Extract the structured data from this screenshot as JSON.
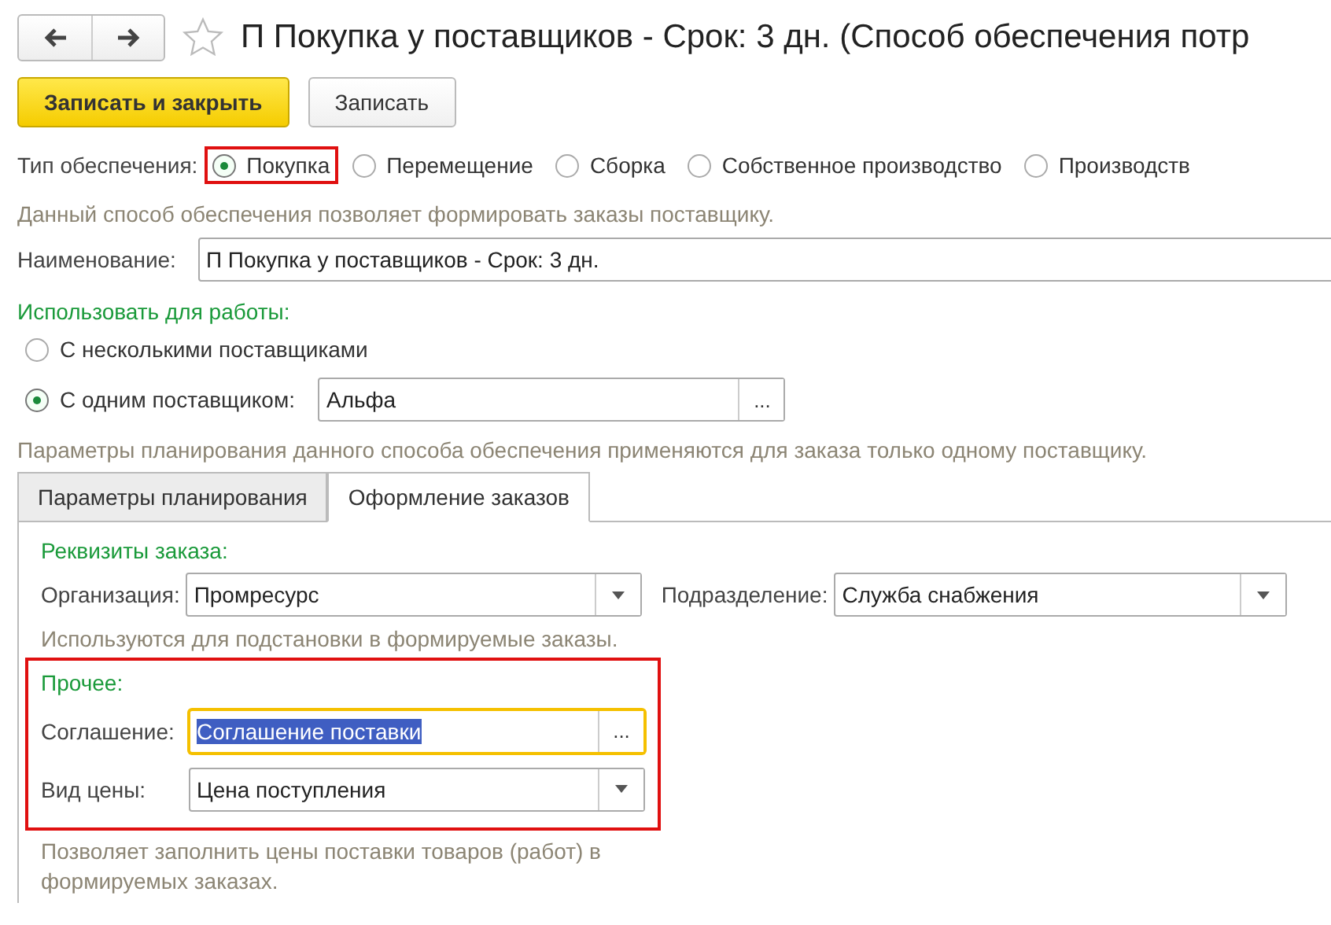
{
  "window": {
    "title": "П Покупка у поставщиков - Срок: 3 дн. (Способ обеспечения потр",
    "favorite": false
  },
  "toolbar": {
    "buttons": [
      {
        "label": "Записать и закрыть",
        "kind": "primary"
      },
      {
        "label": "Записать",
        "kind": "default"
      }
    ]
  },
  "supply_type": {
    "label": "Тип обеспечения:",
    "options": [
      {
        "label": "Покупка",
        "selected": true,
        "annotated": true
      },
      {
        "label": "Перемещение",
        "selected": false,
        "annotated": false
      },
      {
        "label": "Сборка",
        "selected": false,
        "annotated": false
      },
      {
        "label": "Собственное производство",
        "selected": false,
        "annotated": false
      },
      {
        "label": "Производств",
        "selected": false,
        "annotated": false
      }
    ],
    "hint": "Данный способ обеспечения позволяет формировать заказы поставщику."
  },
  "name_field": {
    "label": "Наименование:",
    "value": "П Покупка у поставщиков - Срок: 3 дн."
  },
  "usage": {
    "title": "Использовать для работы:",
    "options": [
      {
        "label": "С несколькими поставщиками",
        "selected": false
      },
      {
        "label": "С одним поставщиком:",
        "selected": true,
        "field_value": "Альфа",
        "button": "..."
      }
    ],
    "hint": "Параметры планирования данного способа обеспечения применяются для заказа только одному поставщику."
  },
  "tabs": [
    {
      "label": "Параметры планирования",
      "selected": false
    },
    {
      "label": "Оформление заказов",
      "selected": true
    }
  ],
  "order_details": {
    "title": "Реквизиты заказа:",
    "fields": [
      {
        "label": "Организация:",
        "value": "Промресурс",
        "kind": "dropdown"
      },
      {
        "label": "Подразделение:",
        "value": "Служба снабжения",
        "kind": "dropdown"
      }
    ],
    "hint": "Используются для подстановки в формируемые заказы."
  },
  "other": {
    "title": "Прочее:",
    "annotated": true,
    "fields": [
      {
        "label": "Соглашение:",
        "value": "Соглашение поставки",
        "kind": "choice",
        "button": "...",
        "focused": true,
        "text_selected": true
      },
      {
        "label": "Вид цены:",
        "value": "Цена поступления",
        "kind": "dropdown",
        "focused": false,
        "text_selected": false
      }
    ],
    "hint": "Позволяет заполнить цены поставки товаров (работ) в формируемых заказах."
  }
}
